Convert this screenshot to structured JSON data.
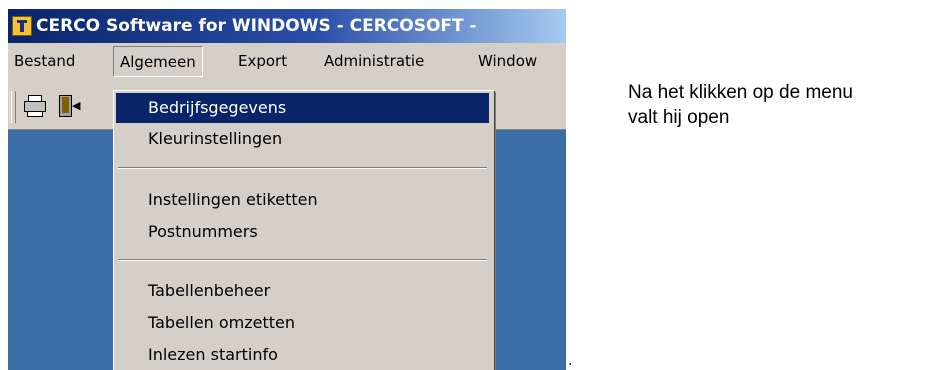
{
  "window": {
    "title": "CERCO Software for WINDOWS - CERCOSOFT -",
    "icon": "cerco-app-icon"
  },
  "menubar": {
    "items": [
      {
        "label": "Bestand"
      },
      {
        "label": "Algemeen"
      },
      {
        "label": "Export"
      },
      {
        "label": "Administratie"
      },
      {
        "label": "Window"
      }
    ],
    "open_menu": "Algemeen"
  },
  "toolbar": {
    "icons": [
      "printer-icon",
      "exit-door-icon"
    ]
  },
  "dropdown": {
    "groups": [
      [
        "Bedrijfsgegevens",
        "Kleurinstellingen"
      ],
      [
        "Instellingen etiketten",
        "Postnummers"
      ],
      [
        "Tabellenbeheer",
        "Tabellen omzetten",
        "Inlezen startinfo"
      ]
    ],
    "highlighted": "Bedrijfsgegevens",
    "highlight_color": "#0a246a"
  },
  "caption": {
    "line1": "Na het klikken op de menu",
    "line2": "valt hij open"
  },
  "trailing_text": "."
}
